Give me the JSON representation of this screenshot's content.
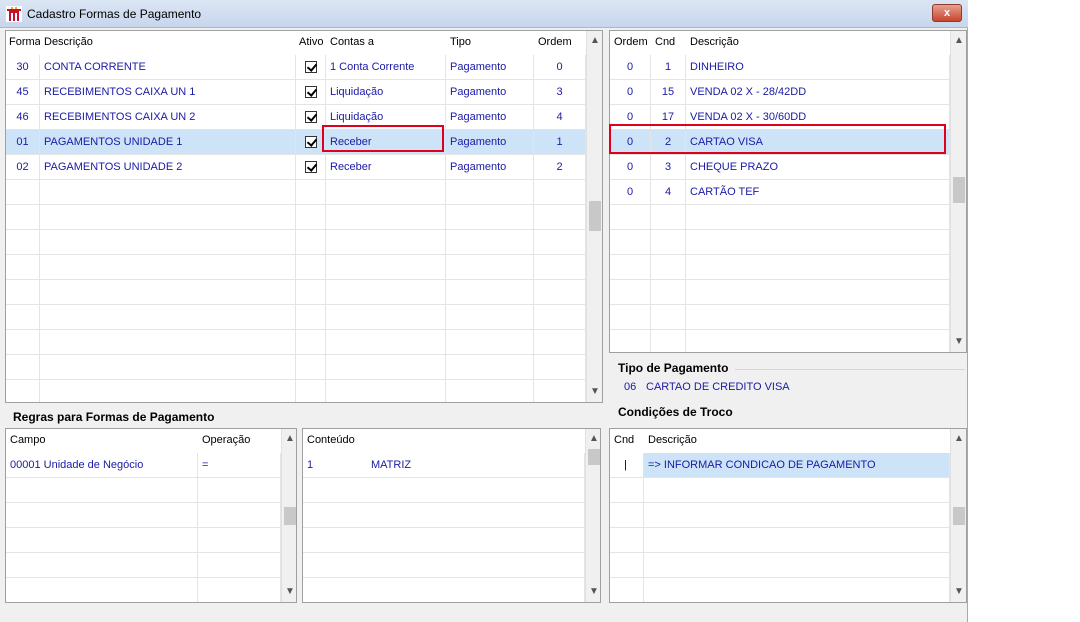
{
  "window": {
    "title": "Cadastro Formas de Pagamento",
    "close_label": "x"
  },
  "formas": {
    "headers": {
      "forma": "Forma",
      "descricao": "Descrição",
      "ativo": "Ativo",
      "contas": "Contas a",
      "tipo": "Tipo",
      "ordem": "Ordem"
    },
    "rows": [
      {
        "forma": "30",
        "descricao": "CONTA CORRENTE",
        "ativo": true,
        "contas": "1 Conta Corrente",
        "tipo": "Pagamento",
        "ordem": "0"
      },
      {
        "forma": "45",
        "descricao": "RECEBIMENTOS CAIXA UN 1",
        "ativo": true,
        "contas": "Liquidação",
        "tipo": "Pagamento",
        "ordem": "3"
      },
      {
        "forma": "46",
        "descricao": "RECEBIMENTOS CAIXA UN 2",
        "ativo": true,
        "contas": "Liquidação",
        "tipo": "Pagamento",
        "ordem": "4"
      },
      {
        "forma": "01",
        "descricao": "PAGAMENTOS UNIDADE 1",
        "ativo": true,
        "contas": "Receber",
        "tipo": "Pagamento",
        "ordem": "1"
      },
      {
        "forma": "02",
        "descricao": "PAGAMENTOS UNIDADE 2",
        "ativo": true,
        "contas": "Receber",
        "tipo": "Pagamento",
        "ordem": "2"
      }
    ]
  },
  "condicoes": {
    "headers": {
      "ordem": "Ordem",
      "cnd": "Cnd",
      "descricao": "Descrição"
    },
    "rows": [
      {
        "ordem": "0",
        "cnd": "1",
        "descricao": "DINHEIRO"
      },
      {
        "ordem": "0",
        "cnd": "15",
        "descricao": "VENDA 02 X - 28/42DD"
      },
      {
        "ordem": "0",
        "cnd": "17",
        "descricao": "VENDA 02 X - 30/60DD"
      },
      {
        "ordem": "0",
        "cnd": "2",
        "descricao": "CARTAO VISA"
      },
      {
        "ordem": "0",
        "cnd": "3",
        "descricao": "CHEQUE PRAZO"
      },
      {
        "ordem": "0",
        "cnd": "4",
        "descricao": "CARTÃO TEF"
      }
    ]
  },
  "tipo_pagamento": {
    "title": "Tipo de Pagamento",
    "code": "06",
    "name": "CARTAO DE CREDITO VISA"
  },
  "regras": {
    "title": "Regras para Formas de Pagamento",
    "headers": {
      "campo": "Campo",
      "operacao": "Operação"
    },
    "rows": [
      {
        "campo": "00001 Unidade de Negócio",
        "operacao": "="
      }
    ]
  },
  "conteudo": {
    "headers": {
      "conteudo": "Conteúdo"
    },
    "rows": [
      {
        "code": "1",
        "name": "MATRIZ"
      }
    ]
  },
  "troco": {
    "title": "Condições de Troco",
    "headers": {
      "cnd": "Cnd",
      "descricao": "Descrição"
    },
    "rows": [
      {
        "cnd": "|",
        "descricao": "=> INFORMAR CONDICAO DE PAGAMENTO"
      }
    ]
  },
  "colors": {
    "text_blue": "#1a1aa6",
    "selection": "#cde3f7",
    "highlight_red": "#e0001b"
  }
}
